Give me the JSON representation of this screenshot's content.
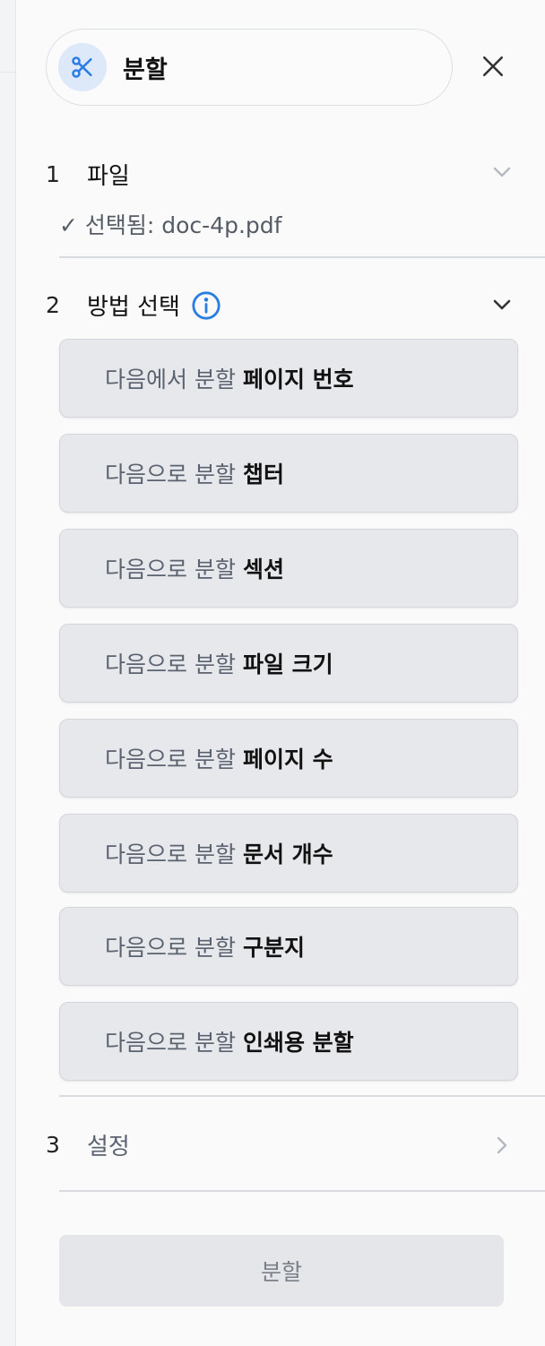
{
  "tool": {
    "title": "분할",
    "icon": "scissors-icon"
  },
  "steps": [
    {
      "number": "1",
      "label": "파일",
      "selected_text": "✓ 선택됨: doc-4p.pdf"
    },
    {
      "number": "2",
      "label": "방법 선택"
    },
    {
      "number": "3",
      "label": "설정"
    }
  ],
  "methods": [
    {
      "prefix": "다음에서 분할",
      "name": "페이지 번호"
    },
    {
      "prefix": "다음으로 분할",
      "name": "챕터"
    },
    {
      "prefix": "다음으로 분할",
      "name": "섹션"
    },
    {
      "prefix": "다음으로 분할",
      "name": "파일 크기"
    },
    {
      "prefix": "다음으로 분할",
      "name": "페이지 수"
    },
    {
      "prefix": "다음으로 분할",
      "name": "문서 개수"
    },
    {
      "prefix": "다음으로 분할",
      "name": "구분지"
    },
    {
      "prefix": "다음으로 분할",
      "name": "인쇄용 분할"
    }
  ],
  "submit_label": "분할",
  "colors": {
    "accent": "#2a7de1",
    "button_bg": "#e7e8eb",
    "pill_icon_bg": "#dde9f8"
  }
}
